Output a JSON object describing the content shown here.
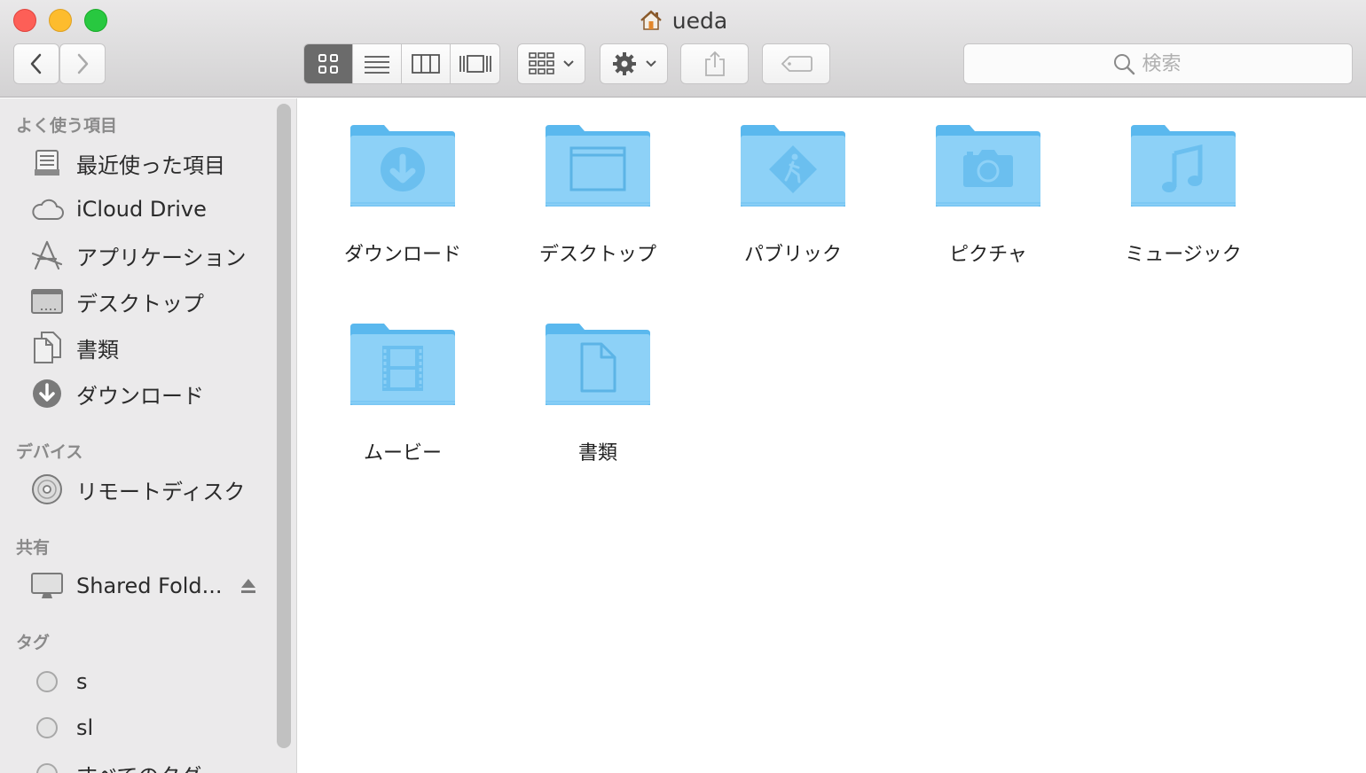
{
  "window": {
    "title": "ueda"
  },
  "toolbar": {
    "back_icon": "chevron-left-icon",
    "forward_icon": "chevron-right-icon",
    "view_modes": [
      "icon-view",
      "list-view",
      "column-view",
      "cover-flow-view"
    ],
    "active_view": "icon-view",
    "search_placeholder": "検索"
  },
  "sidebar": {
    "sections": [
      {
        "title": "よく使う項目"
      },
      {
        "title": "デバイス"
      },
      {
        "title": "共有"
      },
      {
        "title": "タグ"
      }
    ],
    "favorites": [
      {
        "label": "最近使った項目",
        "icon": "recents-icon"
      },
      {
        "label": "iCloud Drive",
        "icon": "cloud-icon"
      },
      {
        "label": "アプリケーション",
        "icon": "applications-icon"
      },
      {
        "label": "デスクトップ",
        "icon": "desktop-icon"
      },
      {
        "label": "書類",
        "icon": "documents-icon"
      },
      {
        "label": "ダウンロード",
        "icon": "download-icon"
      }
    ],
    "devices": [
      {
        "label": "リモートディスク",
        "icon": "disc-icon"
      }
    ],
    "shared": [
      {
        "label": "Shared Fold...",
        "icon": "monitor-icon"
      }
    ],
    "tags": [
      {
        "label": "s"
      },
      {
        "label": "sl"
      },
      {
        "label": "すべてのタグ..."
      }
    ]
  },
  "files": [
    {
      "name": "ダウンロード",
      "icon": "download-folder-icon"
    },
    {
      "name": "デスクトップ",
      "icon": "desktop-folder-icon"
    },
    {
      "name": "パブリック",
      "icon": "public-folder-icon"
    },
    {
      "name": "ピクチャ",
      "icon": "pictures-folder-icon"
    },
    {
      "name": "ミュージック",
      "icon": "music-folder-icon"
    },
    {
      "name": "ムービー",
      "icon": "movies-folder-icon"
    },
    {
      "name": "書類",
      "icon": "documents-folder-icon"
    }
  ],
  "colors": {
    "folder_light": "#8dd1f7",
    "folder_dark": "#5ab8ee",
    "folder_glyph": "#4fa6d9",
    "sidebar_bg": "#ebeaeb"
  }
}
